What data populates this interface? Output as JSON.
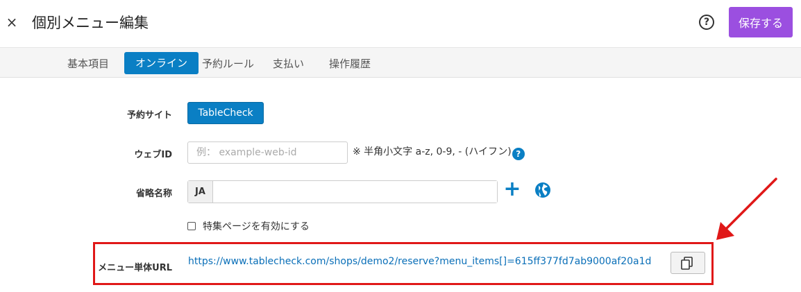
{
  "header": {
    "close_glyph": "×",
    "title": "個別メニュー編集",
    "help_glyph": "?",
    "save_label": "保存する"
  },
  "tabs": [
    {
      "label": "基本項目",
      "active": false
    },
    {
      "label": "オンライン",
      "active": true
    },
    {
      "label": "予約ルール",
      "active": false
    },
    {
      "label": "支払い",
      "active": false
    },
    {
      "label": "操作履歴",
      "active": false
    }
  ],
  "form": {
    "reservation_site": {
      "label": "予約サイト",
      "button": "TableCheck"
    },
    "web_id": {
      "label": "ウェブID",
      "placeholder": "例： example-web-id",
      "value": "",
      "hint": "※ 半角小文字 a-z, 0-9, - (ハイフン)",
      "hint_help_glyph": "?"
    },
    "short_name": {
      "label": "省略名称",
      "lang": "JA",
      "value": "",
      "add_glyph": "+"
    },
    "feature_page": {
      "label": "特集ページを有効にする",
      "checked": false
    },
    "menu_url": {
      "label": "メニュー単体URL",
      "url": "https://www.tablecheck.com/shops/demo2/reserve?menu_items[]=615ff377fd7ab9000af20a1d"
    }
  },
  "colors": {
    "accent": "#0a7fc4",
    "save": "#9b4fe0",
    "highlight": "#e01818"
  },
  "icons": {
    "close": "close-icon",
    "help": "question-circle-icon",
    "add": "plus-icon",
    "globe": "globe-icon",
    "copy": "copy-icon",
    "arrow": "arrow-annotation-icon"
  }
}
